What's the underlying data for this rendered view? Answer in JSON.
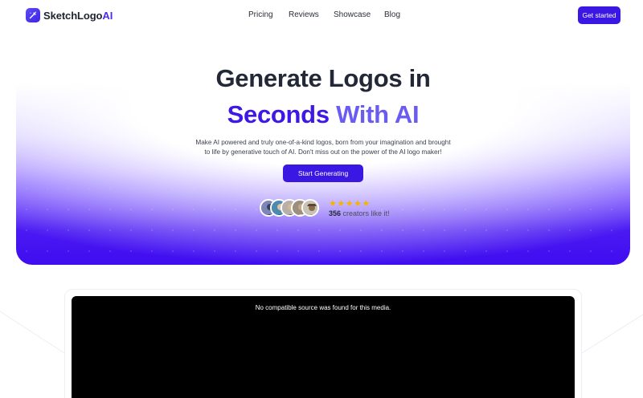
{
  "brand": {
    "name_main": "SketchLogo",
    "name_accent": "AI",
    "accent_color": "#4a2df0"
  },
  "nav": {
    "items": [
      "Pricing",
      "Reviews",
      "Showcase",
      "Blog"
    ]
  },
  "header": {
    "cta_label": "Get started"
  },
  "hero": {
    "title_line1": "Generate Logos in",
    "title_line2_a": "Seconds",
    "title_line2_b": "With AI",
    "subtitle": "Make AI powered and truly one-of-a-kind logos, born from your imagination and brought to life by generative touch of AI. Don't miss out on the power of the AI logo maker!",
    "cta_label": "Start Generating",
    "rating_stars": 5,
    "creators_count": "356",
    "creators_text": "creators like it!",
    "primary_color": "#3b17e4"
  },
  "video": {
    "message": "No compatible source was found for this media."
  }
}
